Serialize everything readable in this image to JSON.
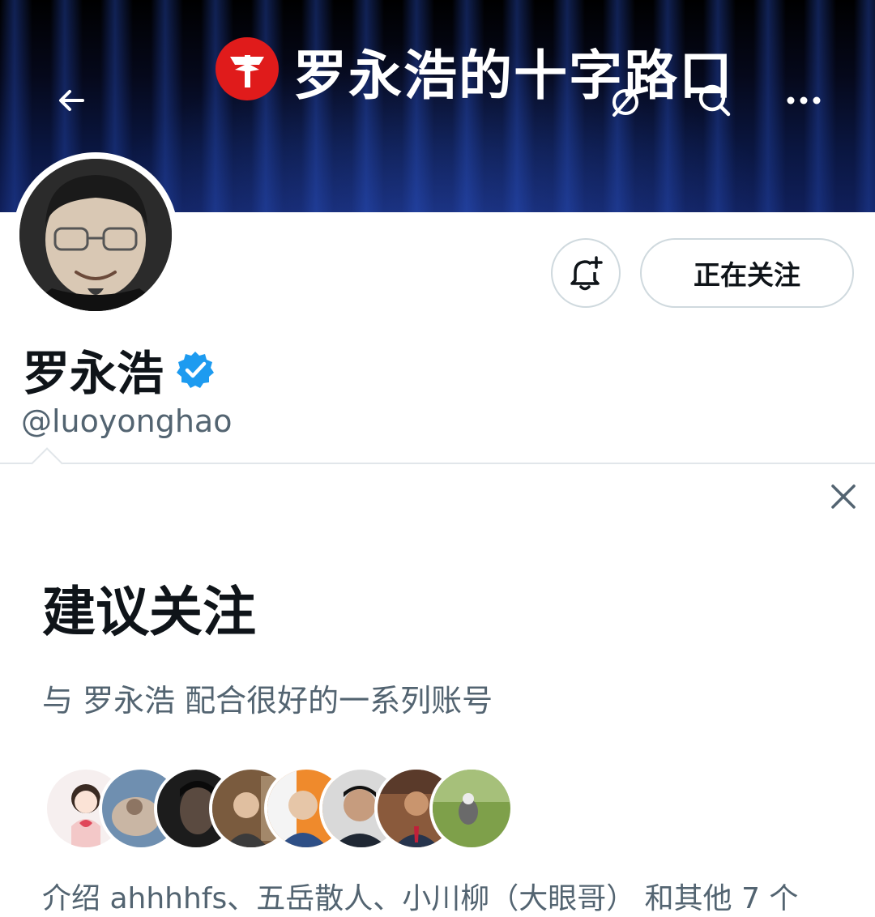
{
  "header": {
    "banner_title": "罗永浩的十字路口",
    "back_icon": "arrow-left-icon",
    "hide_icon": "eye-slash-icon",
    "search_icon": "search-icon",
    "more_icon": "more-horizontal-icon"
  },
  "profile": {
    "display_name": "罗永浩",
    "handle": "@luoyonghao",
    "follow_button_label": "正在关注",
    "notify_icon": "bell-plus-icon",
    "verified_icon": "verified-badge-icon"
  },
  "suggestions": {
    "title": "建议关注",
    "subtitle": "与 罗永浩 配合很好的一系列账号",
    "intro": "介绍 ahhhhfs、五岳散人、小川柳（大眼哥） 和其他 7 个",
    "close_icon": "close-icon",
    "avatar_count": 8
  },
  "colors": {
    "text_primary": "#0f1419",
    "text_secondary": "#536471",
    "border": "#cfd9de",
    "verified": "#1d9bf0",
    "logo_red": "#e01b1b"
  }
}
